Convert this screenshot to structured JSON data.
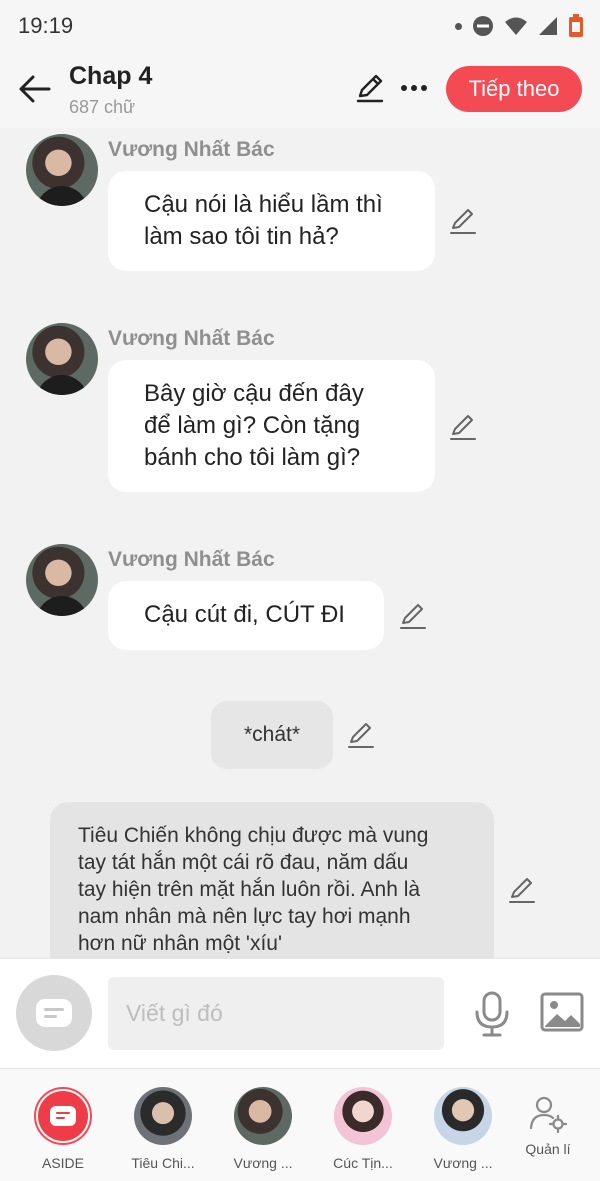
{
  "status_bar": {
    "time": "19:19"
  },
  "header": {
    "title": "Chap 4",
    "word_count": "687 chữ",
    "next_label": "Tiếp theo",
    "accent_color": "#f44a54"
  },
  "messages": [
    {
      "sender": "Vương Nhất Bác",
      "text": [
        "Cậu nói là hiểu lầm thì",
        "làm sao tôi tin hả?"
      ]
    },
    {
      "sender": "Vương Nhất Bác",
      "text": [
        "Bây giờ cậu đến đây",
        "để làm gì? Còn tặng",
        "bánh cho tôi làm gì?"
      ]
    },
    {
      "sender": "Vương Nhất Bác",
      "text": [
        "Cậu cút đi, CÚT ĐI"
      ]
    }
  ],
  "action": {
    "text": "*chát*"
  },
  "narration": {
    "lines": [
      "Tiêu Chiến không chịu được mà vung",
      "tay tát hắn một cái rõ đau, năm dấu",
      "tay hiện trên mặt hắn luôn rồi. Anh là",
      "nam nhân mà nên lực tay hơi mạnh",
      "hơn nữ nhân một 'xíu'"
    ]
  },
  "composer": {
    "placeholder": "Viết gì đó"
  },
  "characters": [
    {
      "name": "ASIDE"
    },
    {
      "name": "Tiêu Chi..."
    },
    {
      "name": "Vương ..."
    },
    {
      "name": "Cúc Tịn..."
    },
    {
      "name": "Vương ..."
    }
  ],
  "manage": {
    "label": "Quản lí"
  },
  "icons": {
    "back": "arrow-left-icon",
    "edit": "pencil-icon",
    "more": "more-dots-icon",
    "mic": "microphone-icon",
    "image": "image-icon",
    "manage": "user-gear-icon"
  }
}
